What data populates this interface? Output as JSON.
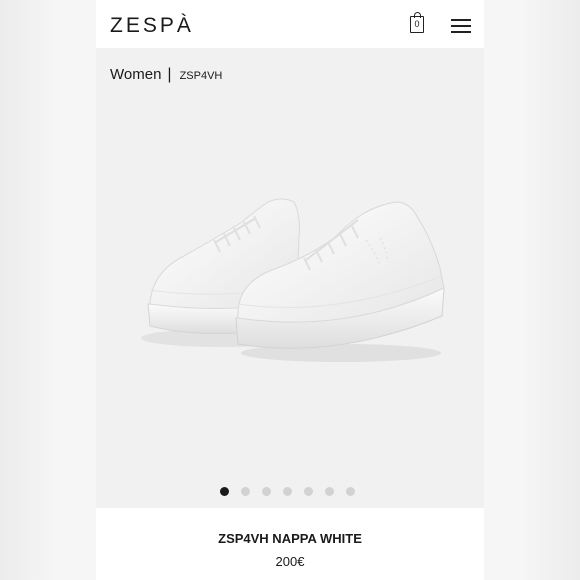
{
  "header": {
    "logo": "ZESPÀ",
    "cart_count": "0",
    "cart_icon": "shopping-bag-icon",
    "menu_icon": "hamburger-menu-icon"
  },
  "breadcrumb": {
    "category": "Women",
    "separator": "|",
    "product_code": "ZSP4VH"
  },
  "gallery": {
    "image": "white-sneakers-product-image",
    "slide_count": 7,
    "active_index": 0
  },
  "product": {
    "name": "ZSP4VH NAPPA WHITE",
    "price": "200€"
  },
  "colors": {
    "background": "#f1f1f1",
    "header": "#ffffff",
    "text": "#1a1a1a",
    "dot_active": "#1a1a1a",
    "dot_inactive": "#d2d2d2"
  }
}
